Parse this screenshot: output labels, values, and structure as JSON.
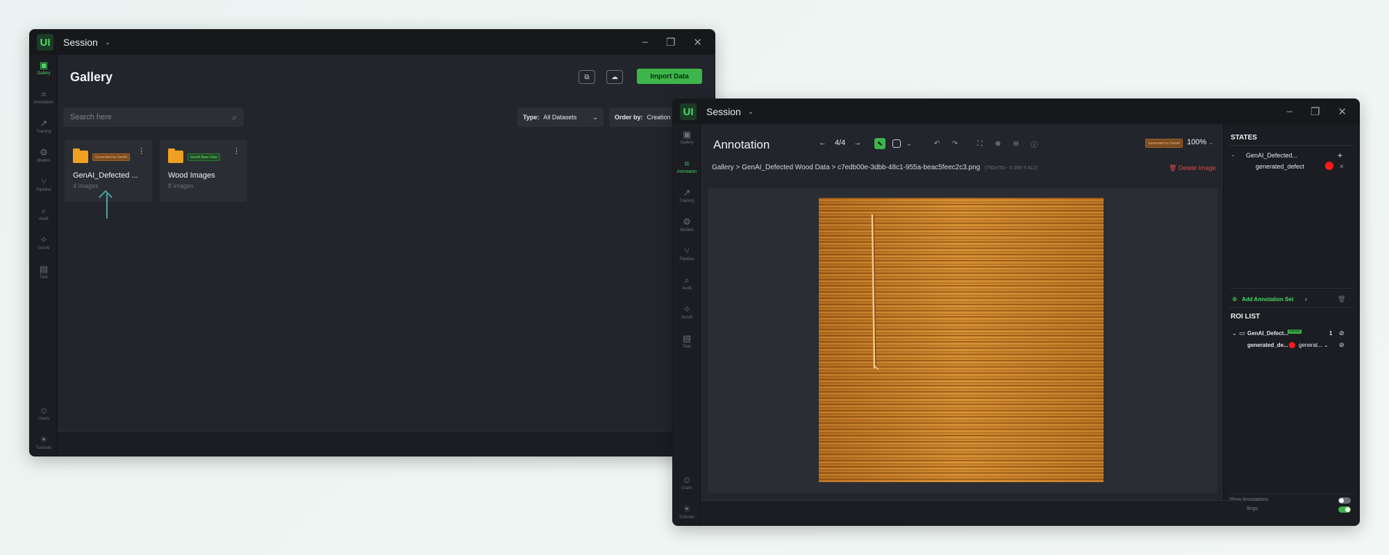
{
  "gallery_window": {
    "title": "Session",
    "header": "Gallery",
    "import_label": "Import Data",
    "search_placeholder": "Search here",
    "type_label": "Type:",
    "type_value": "All Datasets",
    "order_label": "Order by:",
    "order_value": "Creation",
    "sidebar": [
      "Gallery",
      "Annotation",
      "Training",
      "Models",
      "Pipeline",
      "Audit",
      "GenAI",
      "Task",
      "Users",
      "Tutorials"
    ],
    "cards": [
      {
        "title": "GenAI_Defected ...",
        "count": "4 images",
        "badge": "Generated by GenAI"
      },
      {
        "title": "Wood Images",
        "count": "8 images",
        "badge": "GenAI Base Data"
      }
    ]
  },
  "annotation_window": {
    "title": "Session",
    "header": "Annotation",
    "pager": "4/4",
    "gen_badge": "Generated by GenAI",
    "zoom": "100%",
    "breadcrumb": {
      "gallery": "Gallery",
      "dataset": "GenAI_Defected Wood Data",
      "file": "c7edb00e-3dbb-48c1-955a-beac5feec2c3.png",
      "meta": "(750x750 - X:399 Y:412)"
    },
    "delete_label": "Delete Image",
    "sidebar": [
      "Gallery",
      "Annotation",
      "Training",
      "Models",
      "Pipeline",
      "Audit",
      "GenAI",
      "Task",
      "Users",
      "Tutorials"
    ],
    "states_header": "STATES",
    "state_set": "GenAI_Defected...",
    "state_class": "generated_defect",
    "add_set_label": "Add Annotation Set",
    "roi_header": "ROI LIST",
    "roi_set": "GenAI_Defect...",
    "roi_set_tag": "Model",
    "roi_count": "1",
    "roi_item": "generated_de...",
    "roi_item_type": "generat...",
    "show_annotations": "Show Annotations",
    "show_fillings": "Show Fillings",
    "accent": "#3db54a",
    "defect_color": "#ff1a1a"
  }
}
